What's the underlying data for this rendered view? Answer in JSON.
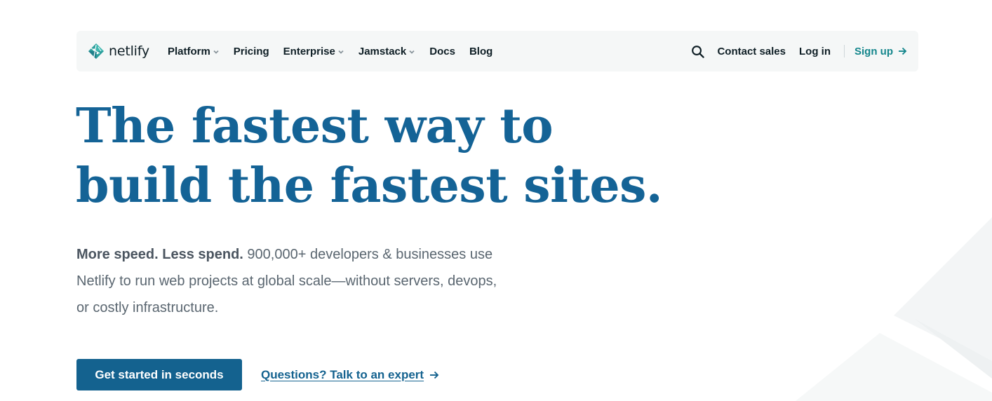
{
  "brand": {
    "name": "netlify",
    "logo_icon": "netlify-diamond-logo",
    "colors": {
      "headline": "#146396",
      "primary_button": "#14628f",
      "signup_link": "#14868c",
      "nav_background": "#f5f7f7"
    }
  },
  "nav": {
    "links": [
      {
        "label": "Platform",
        "dropdown": true
      },
      {
        "label": "Pricing",
        "dropdown": false
      },
      {
        "label": "Enterprise",
        "dropdown": true
      },
      {
        "label": "Jamstack",
        "dropdown": true
      },
      {
        "label": "Docs",
        "dropdown": false
      },
      {
        "label": "Blog",
        "dropdown": false
      }
    ],
    "search_icon": "search-icon",
    "contact_sales": "Contact sales",
    "log_in": "Log in",
    "sign_up": "Sign up"
  },
  "hero": {
    "headline_line1": "The fastest way to",
    "headline_line2": "build the fastest sites.",
    "lede_strong": "More speed. Less spend.",
    "lede_text": " 900,000+ developers & businesses use Netlify to run web projects at global scale—without servers, devops, or costly infrastructure.",
    "primary_cta": "Get started in seconds",
    "secondary_cta": "Questions? Talk to an expert"
  }
}
